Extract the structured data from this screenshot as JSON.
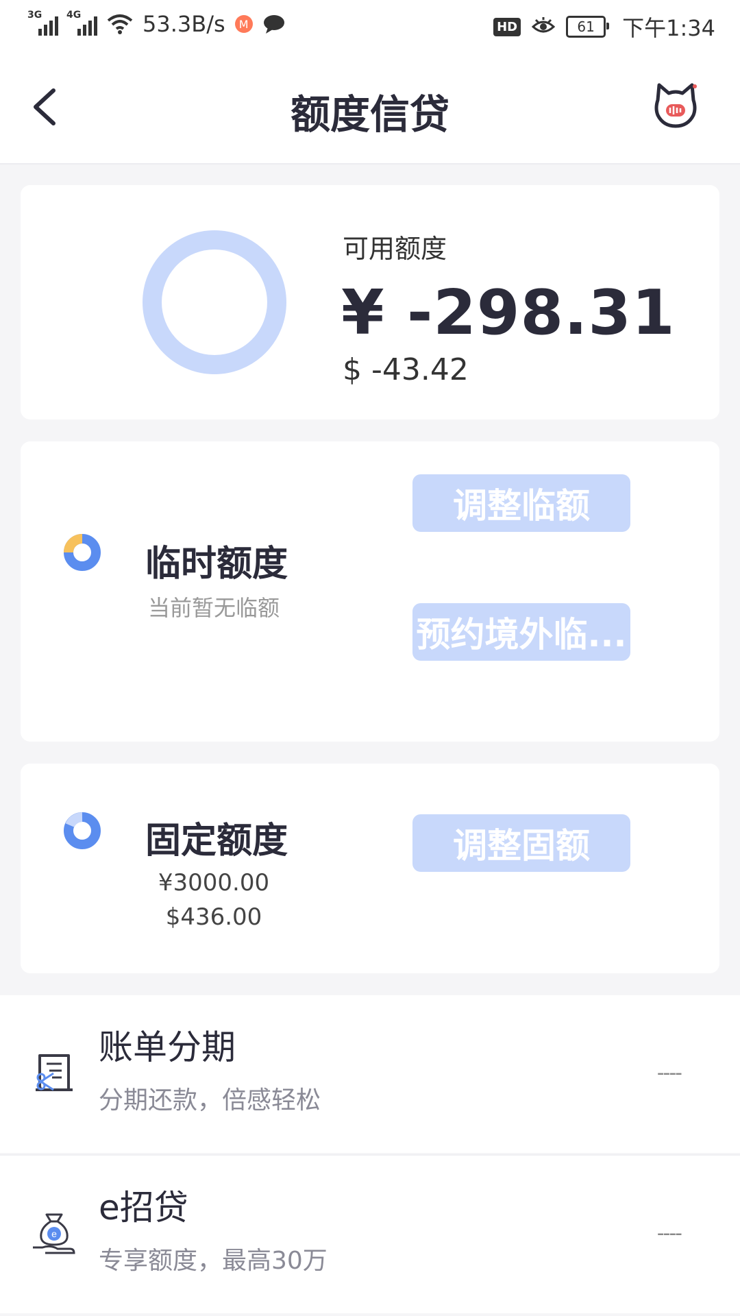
{
  "status_bar": {
    "network1": "3G",
    "network2": "4G",
    "speed": "53.3B/s",
    "hd": "HD",
    "battery": "61",
    "time": "下午1:34"
  },
  "header": {
    "title": "额度信贷",
    "back_icon": "chevron-left-icon",
    "right_icon": "cat-mascot-icon"
  },
  "available": {
    "label": "可用额度",
    "cny": "¥ -298.31",
    "usd": "$ -43.42",
    "ring_color": "#c8d8fb"
  },
  "temporary": {
    "title": "临时额度",
    "subtitle": "当前暂无临额",
    "adjust_button": "调整临额",
    "reserve_button": "预约境外临..."
  },
  "fixed": {
    "title": "固定额度",
    "amount_cny": "¥3000.00",
    "amount_usd": "$436.00",
    "adjust_button": "调整固额"
  },
  "list": [
    {
      "title": "账单分期",
      "subtitle": "分期还款，倍感轻松",
      "right": "----",
      "icon": "installment-icon"
    },
    {
      "title": "e招贷",
      "subtitle": "专享额度，最高30万",
      "right": "----",
      "icon": "loan-bag-icon"
    }
  ],
  "colors": {
    "accent": "#5b8def",
    "button_bg": "#c8d8fb",
    "yellow": "#f7c15c"
  }
}
